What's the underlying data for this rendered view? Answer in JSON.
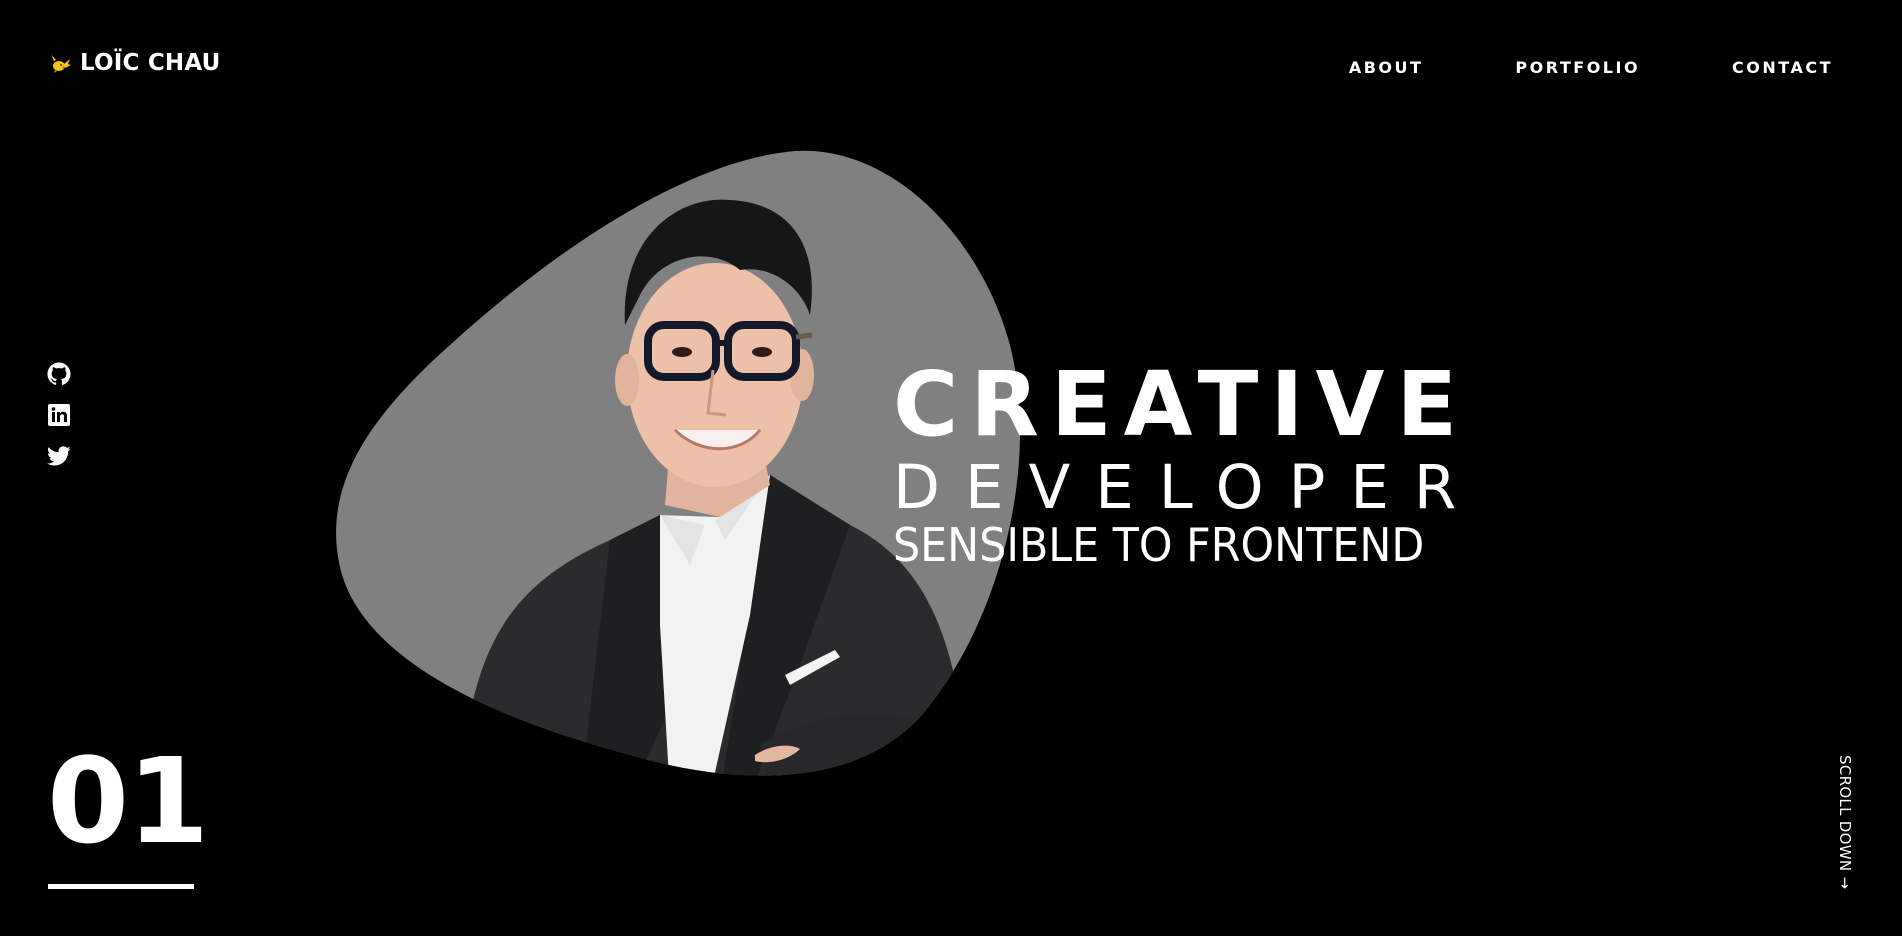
{
  "header": {
    "brand_name": "LOÏC CHAU",
    "brand_logo_icon": "pikachu-logo-icon",
    "nav": [
      {
        "label": "ABOUT"
      },
      {
        "label": "PORTFOLIO"
      },
      {
        "label": "CONTACT"
      }
    ]
  },
  "socials": [
    {
      "icon": "github-icon"
    },
    {
      "icon": "linkedin-icon"
    },
    {
      "icon": "twitter-icon"
    }
  ],
  "hero": {
    "line1": "CREATIVE",
    "line2": "DEVELOPER",
    "line3": "SENSIBLE TO FRONTEND",
    "portrait_icon": "portrait-photo"
  },
  "section": {
    "number": "01"
  },
  "scroll": {
    "label": "SCROLL DOWN →"
  },
  "colors": {
    "background": "#000000",
    "text": "#ffffff",
    "blob": "#808080",
    "logo_yellow": "#f5c518"
  }
}
